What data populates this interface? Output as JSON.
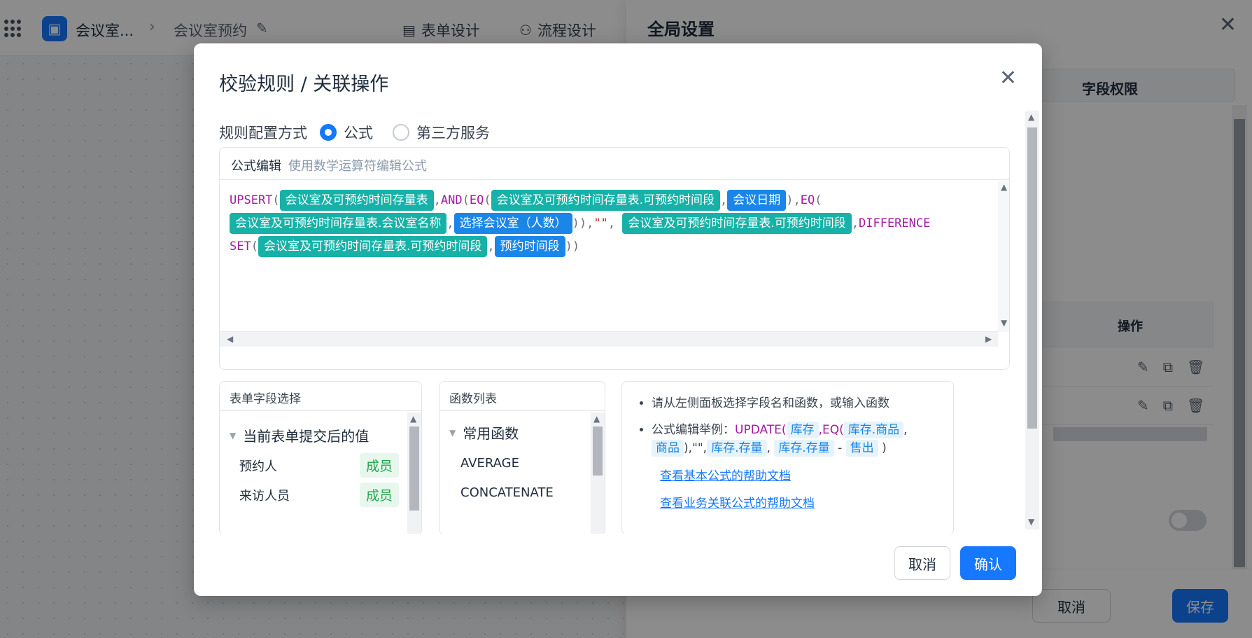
{
  "header": {
    "app_name": "会议室...",
    "breadcrumb_sep": "›",
    "page_name": "会议室预约",
    "tab_form": "表单设计",
    "tab_flow": "流程设计"
  },
  "drawer": {
    "title": "全局设置",
    "tab_field_perm": "字段权限",
    "ops_header": "操作",
    "cancel": "取消",
    "save": "保存"
  },
  "modal": {
    "title": "校验规则 / 关联操作",
    "rule_label": "规则配置方式",
    "option_formula": "公式",
    "option_third": "第三方服务",
    "formula_label": "公式编辑",
    "formula_hint": "使用数学运算符编辑公式",
    "formula": {
      "upsert": "UPSERT",
      "and": "AND",
      "eq": "EQ",
      "diff1": "DIFFERENCE",
      "diff2": "SET",
      "t1": "会议室及可预约时间存量表",
      "t2": "会议室及可预约时间存量表.可预约时间段",
      "t3": "会议日期",
      "t4": "会议室及可预约时间存量表.会议室名称",
      "t5": "选择会议室（人数）",
      "t6": "会议室及可预约时间存量表.可预约时间段",
      "t7": "会议室及可预约时间存量表.可预约时间段",
      "t8": "预约时间段",
      "empty_str": "\"\""
    },
    "fields_panel": {
      "title": "表单字段选择",
      "group": "当前表单提交后的值",
      "rows": [
        {
          "name": "预约人",
          "type": "成员"
        },
        {
          "name": "来访人员",
          "type": "成员"
        }
      ]
    },
    "functions_panel": {
      "title": "函数列表",
      "group": "常用函数",
      "items": [
        "AVERAGE",
        "CONCATENATE"
      ]
    },
    "help": {
      "line1": "请从左侧面板选择字段名和函数，或输入函数",
      "example_prefix": "公式编辑举例：",
      "ex_update": "UPDATE(",
      "ex_kc": "库存",
      "ex_eq": ",EQ(",
      "ex_kcsp": "库存.商品",
      "ex_sp": "商品",
      "ex_mid": "),\"\",",
      "ex_kccl": "库存.存量",
      "ex_kccl2": "库存.存量",
      "ex_minus": "-",
      "ex_sc": "售出",
      "ex_end": ")",
      "link_basic": "查看基本公式的帮助文档",
      "link_business": "查看业务关联公式的帮助文档"
    },
    "cancel": "取消",
    "confirm": "确认"
  }
}
